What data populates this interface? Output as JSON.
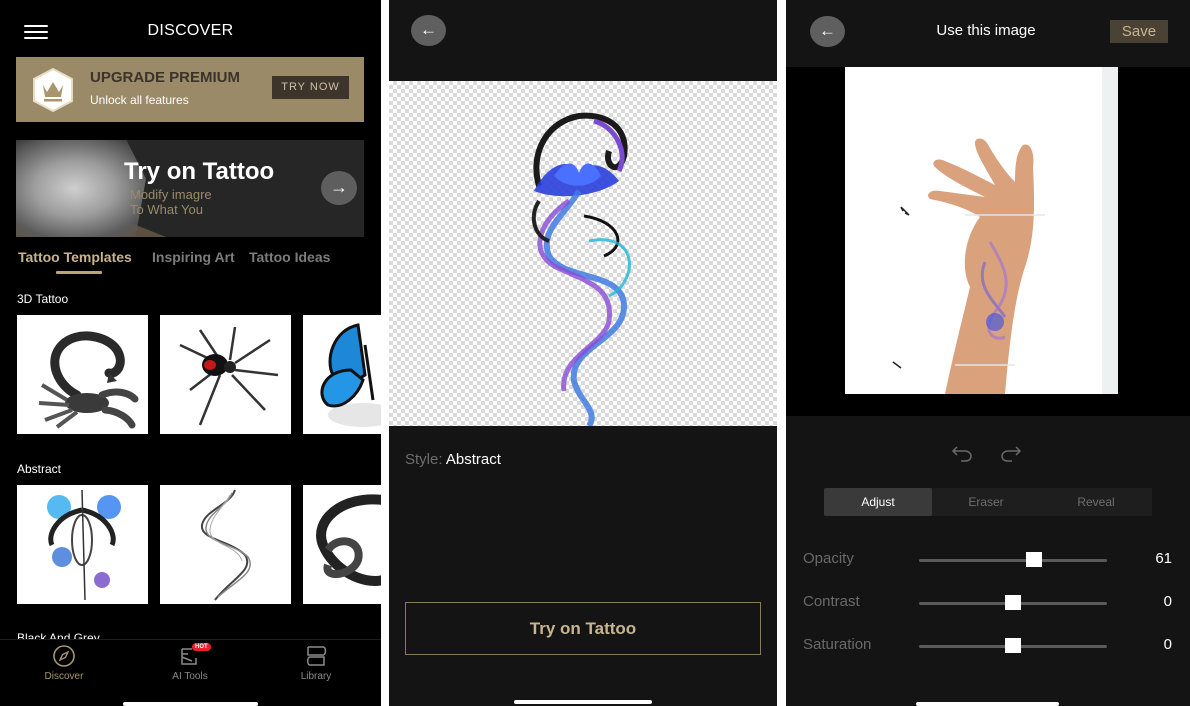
{
  "colors": {
    "accent_gold": "#c8b58f",
    "premium_bg": "#9b8a68",
    "panel_bg": "#141414",
    "discover_bg": "#000000",
    "hot_badge": "#e8202a"
  },
  "discover": {
    "title": "DISCOVER",
    "menu_icon": "hamburger-icon",
    "premium": {
      "icon": "crown-icon",
      "title": "UPGRADE PREMIUM",
      "subtitle": "Unlock all features",
      "button": "TRY NOW"
    },
    "banner": {
      "title": "Try on Tattoo",
      "subtitle_line1": "Modify imagre",
      "subtitle_line2": "To What You",
      "arrow_icon": "arrow-right-icon"
    },
    "tabs": [
      {
        "label": "Tattoo Templates",
        "active": true
      },
      {
        "label": "Inspiring Art",
        "active": false
      },
      {
        "label": "Tattoo Ideas",
        "active": false
      }
    ],
    "sections": [
      {
        "label": "3D Tattoo",
        "items": [
          "scorpion",
          "spider",
          "butterfly"
        ]
      },
      {
        "label": "Abstract",
        "items": [
          "angel-warrior",
          "smoke-swirl",
          "ribbon-knot"
        ]
      },
      {
        "label": "Black And Grey",
        "items": []
      }
    ],
    "bottom_nav": [
      {
        "label": "Discover",
        "icon": "compass-icon",
        "active": true
      },
      {
        "label": "AI Tools",
        "icon": "ai-tools-icon",
        "badge": "HOT",
        "active": false
      },
      {
        "label": "Library",
        "icon": "library-icon",
        "active": false
      }
    ]
  },
  "preview": {
    "back_icon": "arrow-left-icon",
    "style_label": "Style:",
    "style_value": "Abstract",
    "try_button": "Try on Tattoo"
  },
  "editor": {
    "back_icon": "arrow-left-icon",
    "title": "Use this image",
    "save_button": "Save",
    "undo_icon": "undo-icon",
    "redo_icon": "redo-icon",
    "modes": [
      {
        "label": "Adjust",
        "active": true
      },
      {
        "label": "Eraser",
        "active": false
      },
      {
        "label": "Reveal",
        "active": false
      }
    ],
    "sliders": [
      {
        "label": "Opacity",
        "value": "61",
        "position_fraction": 0.61
      },
      {
        "label": "Contrast",
        "value": "0",
        "position_fraction": 0.5
      },
      {
        "label": "Saturation",
        "value": "0",
        "position_fraction": 0.5
      }
    ]
  }
}
